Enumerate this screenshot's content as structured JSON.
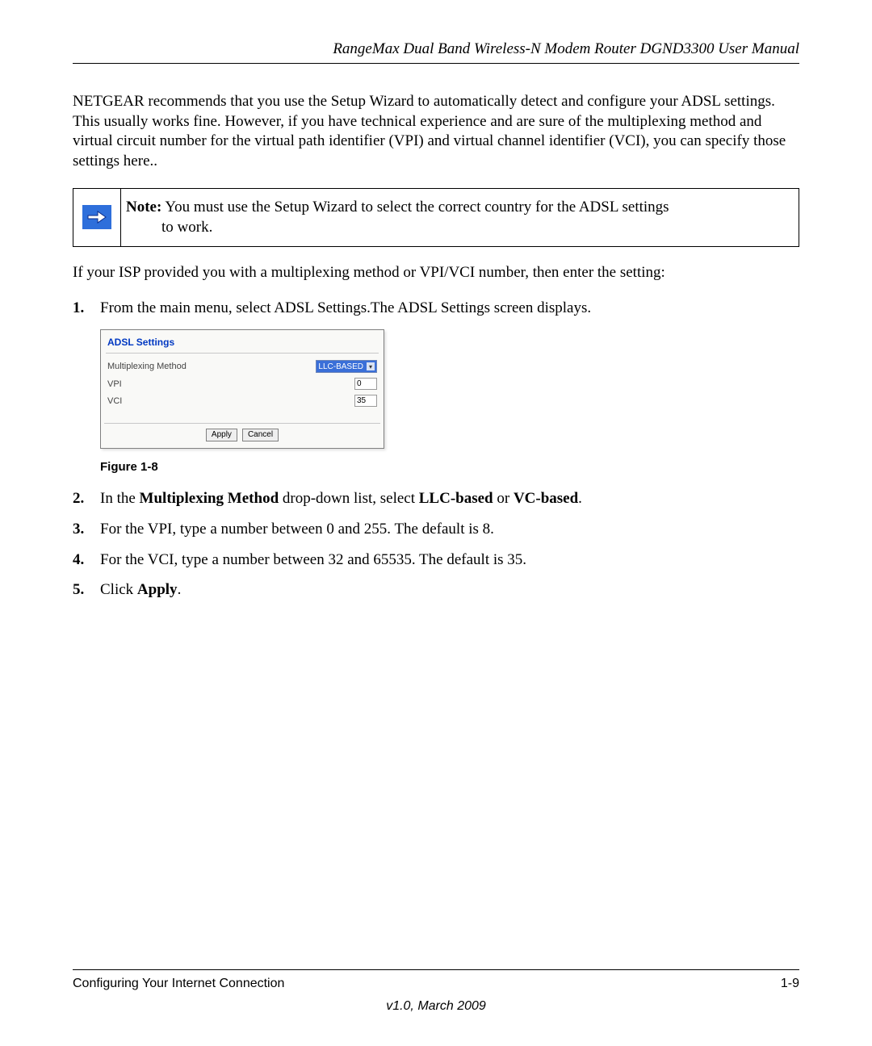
{
  "header": {
    "title": "RangeMax Dual Band Wireless-N Modem Router DGND3300 User Manual"
  },
  "intro": "NETGEAR recommends that you use the Setup Wizard to automatically detect and configure your ADSL settings. This usually works fine. However, if you have technical experience and are sure of the multiplexing method and virtual circuit number for the virtual path identifier (VPI) and virtual channel identifier (VCI), you can specify those settings here..",
  "note": {
    "label": "Note:",
    "text_line1": "You must use the Setup Wizard to select the correct country for the ADSL settings",
    "text_line2": "to work."
  },
  "para2": "If your ISP provided you with a multiplexing method or VPI/VCI number, then enter the setting:",
  "steps": {
    "s1": {
      "num": "1.",
      "text": "From the main menu, select ADSL Settings.The ADSL Settings screen displays."
    },
    "s2": {
      "num": "2.",
      "pre": "In the ",
      "b1": "Multiplexing Method",
      "mid": " drop-down list, select ",
      "b2": "LLC-based",
      "mid2": " or ",
      "b3": "VC-based",
      "post": "."
    },
    "s3": {
      "num": "3.",
      "text": "For the VPI, type a number between 0 and 255. The default is 8."
    },
    "s4": {
      "num": "4.",
      "text": "For the VCI, type a number between 32 and 65535. The default is 35."
    },
    "s5": {
      "num": "5.",
      "pre": "Click ",
      "b1": "Apply",
      "post": "."
    }
  },
  "screenshot": {
    "title": "ADSL Settings",
    "rows": {
      "mux": {
        "label": "Multiplexing Method",
        "value": "LLC-BASED"
      },
      "vpi": {
        "label": "VPI",
        "value": "0"
      },
      "vci": {
        "label": "VCI",
        "value": "35"
      }
    },
    "buttons": {
      "apply": "Apply",
      "cancel": "Cancel"
    }
  },
  "figure_caption": "Figure 1-8",
  "footer": {
    "section": "Configuring Your Internet Connection",
    "page": "1-9",
    "version": "v1.0, March 2009"
  }
}
